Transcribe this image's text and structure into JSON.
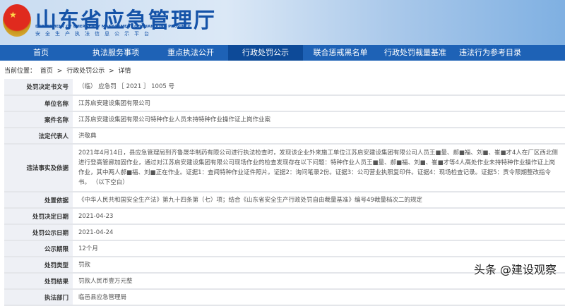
{
  "header": {
    "title": "山东省应急管理厅",
    "subtitle_en": "DEPARTMENT OF EMERGENCY MANAGEMENT OF SHANDONG PROVINCE",
    "subtitle_cn": "安全生产执法信息公示平台"
  },
  "nav": [
    "首页",
    "执法服务事项",
    "重点执法公开",
    "行政处罚公示",
    "联合惩戒黑名单",
    "行政处罚裁量基准",
    "违法行为参考目录"
  ],
  "breadcrumb": {
    "prefix": "当前位置：",
    "items": [
      "首页",
      ">",
      "行政处罚公示",
      ">",
      "详情"
    ]
  },
  "rows": [
    {
      "label": "处罚决定书文号",
      "value": "（临） 应急罚 ［ 2021 ］ 1005 号"
    },
    {
      "label": "单位名称",
      "value": "江苏启安建设集团有限公司"
    },
    {
      "label": "案件名称",
      "value": "江苏启安建设集团有限公司特种作业人员未持特种作业操作证上岗作业案"
    },
    {
      "label": "法定代表人",
      "value": "洪敬典"
    },
    {
      "label": "违法事实及依据",
      "value": "2021年4月14日，县应急管理局到齐鲁晟华制药有限公司进行执法检查时，发现该企业外来施工单位江苏启安建设集团有限公司人员王■量、郝■福、刘■、崔■才4人在厂区西北侧进行登高管廊加固作业，通过对江苏启安建设集团有限公司现场作业的检查发现存在以下问题：特种作业人员王■量、郝■福、刘■、崔■才等4人高处作业未持特种作业操作证上岗作业，其中两人郝■福、刘■正在作业。证据1：查阅特种作业证件照片。证据2：询问笔录2份。证据3：公司营业执照复印件。证据4：现场检查记录。证据5：责令限期整改指令书。 （以下空白）"
    },
    {
      "label": "处置依据",
      "value": "《中华人民共和国安全生产法》第九十四条第（七）项；结合《山东省安全生产行政处罚自由裁量基准》编号49裁量档次二的规定"
    },
    {
      "label": "处罚决定日期",
      "value": "2021-04-23"
    },
    {
      "label": "处罚公示日期",
      "value": "2021-04-24"
    },
    {
      "label": "公示期限",
      "value": "12个月"
    },
    {
      "label": "处罚类型",
      "value": "罚款"
    },
    {
      "label": "处罚结果",
      "value": "罚款人民币壹万元整"
    },
    {
      "label": "执法部门",
      "value": "临邑县应急管理局"
    }
  ],
  "watermark": "头条 @建设观察"
}
